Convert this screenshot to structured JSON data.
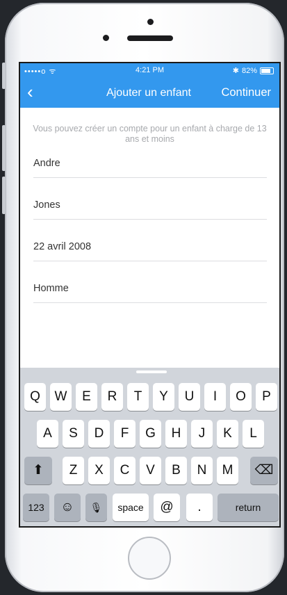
{
  "status_bar": {
    "carrier": "•••••o ᯤ",
    "time": "4:21 PM",
    "bluetooth": "✱",
    "battery": "82%",
    "battery_level": 0.82
  },
  "nav": {
    "back_icon": "‹",
    "title": "Ajouter un enfant",
    "continue": "Continuer"
  },
  "intro_text": "Vous pouvez créer un compte pour un enfant à charge de 13 ans et moins",
  "form": {
    "first_name": "Andre",
    "last_name": "Jones",
    "birth_date": "22 avril 2008",
    "gender": "Homme"
  },
  "keyboard": {
    "row1": [
      "Q",
      "W",
      "E",
      "R",
      "T",
      "Y",
      "U",
      "I",
      "O",
      "P"
    ],
    "row2": [
      "A",
      "S",
      "D",
      "F",
      "G",
      "H",
      "J",
      "K",
      "L"
    ],
    "row3": [
      "Z",
      "X",
      "C",
      "V",
      "B",
      "N",
      "M"
    ],
    "shift_icon": "⬆",
    "delete_icon": "⌫",
    "numbers": "123",
    "emoji_icon": "☺",
    "mic_icon": "🎙",
    "space": "space",
    "at": "@",
    "period": ".",
    "return": "return"
  },
  "colors": {
    "header_bg": "#3398ee",
    "keyboard_bg": "#d1d5db"
  }
}
